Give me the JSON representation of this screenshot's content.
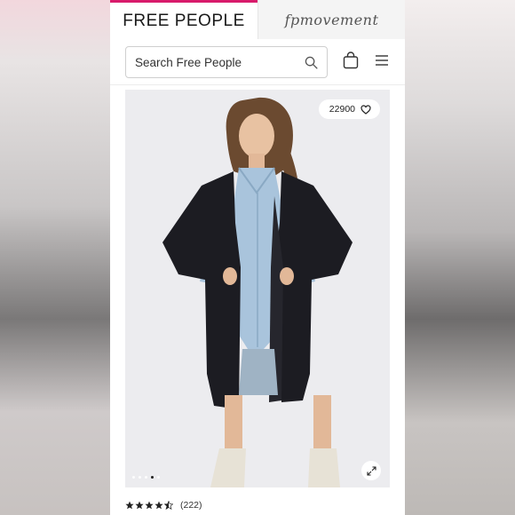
{
  "brand_tabs": {
    "free_people": "FREE PEOPLE",
    "fp_movement": "fpmovement"
  },
  "search": {
    "placeholder": "Search Free People",
    "value": ""
  },
  "icons": {
    "search": "search-icon",
    "bag": "shopping-bag-icon",
    "menu": "hamburger-menu-icon",
    "like": "heart-icon",
    "expand": "expand-arrows-icon",
    "star": "star-icon"
  },
  "product": {
    "likes": "22900",
    "carousel": {
      "total": 5,
      "active": 4
    },
    "rating": 4.5,
    "review_count": "(222)"
  },
  "colors": {
    "accent": "#d81b6b",
    "text": "#1a1a1a",
    "image_bg": "#ececef"
  }
}
